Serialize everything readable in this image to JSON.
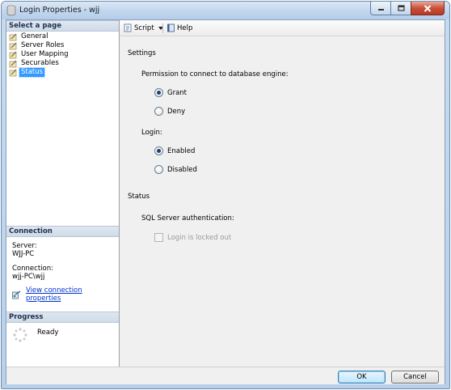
{
  "window": {
    "title": "Login Properties - wjj"
  },
  "left_pane": {
    "select_page_header": "Select a page",
    "pages": [
      {
        "label": "General",
        "selected": false
      },
      {
        "label": "Server Roles",
        "selected": false
      },
      {
        "label": "User Mapping",
        "selected": false
      },
      {
        "label": "Securables",
        "selected": false
      },
      {
        "label": "Status",
        "selected": true
      }
    ],
    "connection_header": "Connection",
    "server_label": "Server:",
    "server_value": "WJJ-PC",
    "connection_label": "Connection:",
    "connection_value": "wjj-PC\\wjj",
    "view_connection_link": "View connection properties",
    "progress_header": "Progress",
    "progress_status": "Ready"
  },
  "toolbar": {
    "script_label": "Script",
    "help_label": "Help"
  },
  "content": {
    "settings_label": "Settings",
    "permission_label": "Permission to connect to database engine:",
    "grant_label": "Grant",
    "deny_label": "Deny",
    "permission_selected": "Grant",
    "login_label": "Login:",
    "enabled_label": "Enabled",
    "disabled_label": "Disabled",
    "login_selected": "Enabled",
    "status_label": "Status",
    "sql_auth_label": "SQL Server authentication:",
    "locked_out_label": "Login is locked out",
    "locked_out_checked": false
  },
  "footer": {
    "ok_label": "OK",
    "cancel_label": "Cancel"
  }
}
